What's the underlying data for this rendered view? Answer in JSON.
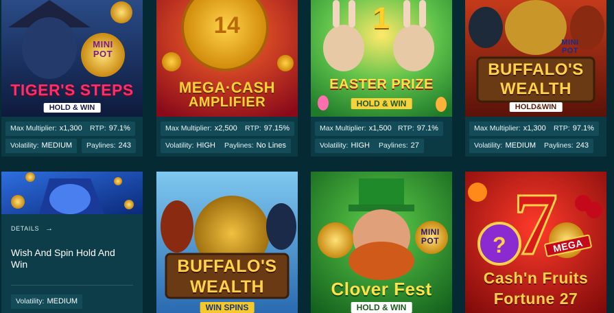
{
  "games": [
    {
      "title_line1": "TIGER'S STEPS",
      "tag": "HOLD & WIN",
      "badge": "MINI POT",
      "max_multiplier_label": "Max Multiplier:",
      "max_multiplier": "x1,300",
      "rtp_label": "RTP:",
      "rtp": "97.1%",
      "volatility_label": "Volatility:",
      "volatility": "MEDIUM",
      "paylines_label": "Paylines:",
      "paylines": "243"
    },
    {
      "title_line1": "MEGA·CASH",
      "title_line2": "AMPLIFIER",
      "badge": "14",
      "max_multiplier_label": "Max Multiplier:",
      "max_multiplier": "x2,500",
      "rtp_label": "RTP:",
      "rtp": "97.15%",
      "volatility_label": "Volatility:",
      "volatility": "HIGH",
      "paylines_label": "Paylines:",
      "paylines": "No Lines"
    },
    {
      "title_line1": "EASTER PRIZE",
      "tag": "HOLD & WIN",
      "badge": "1",
      "max_multiplier_label": "Max Multiplier:",
      "max_multiplier": "x1,500",
      "rtp_label": "RTP:",
      "rtp": "97.1%",
      "volatility_label": "Volatility:",
      "volatility": "HIGH",
      "paylines_label": "Paylines:",
      "paylines": "27"
    },
    {
      "title_line1": "BUFFALO'S",
      "title_line2": "WEALTH",
      "tag": "HOLD&WIN",
      "badge": "MINI POT",
      "max_multiplier_label": "Max Multiplier:",
      "max_multiplier": "x1,300",
      "rtp_label": "RTP:",
      "rtp": "97.1%",
      "volatility_label": "Volatility:",
      "volatility": "MEDIUM",
      "paylines_label": "Paylines:",
      "paylines": "243"
    },
    {
      "details_label": "DETAILS",
      "name": "Wish And Spin Hold And Win",
      "volatility_label": "Volatility:",
      "volatility": "MEDIUM"
    },
    {
      "title_line1": "BUFFALO'S",
      "title_line2": "WEALTH",
      "tag": "WIN SPINS"
    },
    {
      "title_line1": "Clover Fest",
      "tag": "HOLD & WIN",
      "badge": "MINI POT"
    },
    {
      "title_line1": "Cash'n Fruits",
      "title_line2": "Fortune 27",
      "badge": "MEGA"
    }
  ],
  "colors": {
    "page_bg": "#062a33",
    "card_bg": "#0b3a45",
    "chip_bg": "#134c58"
  }
}
